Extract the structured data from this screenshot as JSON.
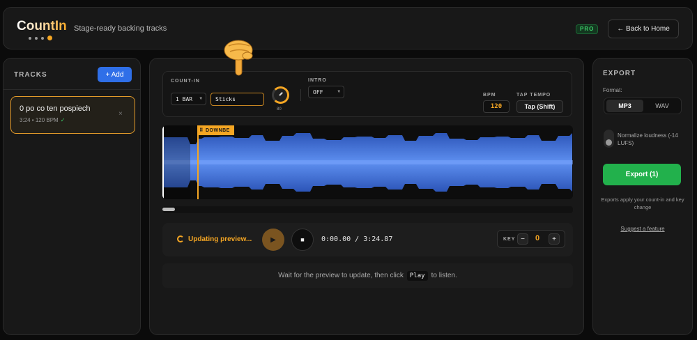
{
  "header": {
    "logo": "CountIn",
    "tagline": "Stage-ready backing tracks",
    "pro_badge": "PRO",
    "home_button": "← Back to Home"
  },
  "tracks": {
    "title": "TRACKS",
    "add_button": "+ Add",
    "items": [
      {
        "name": "0 po co ten pospiech",
        "meta": "3:24 • 120 BPM",
        "status": "✓",
        "remove": "×"
      }
    ]
  },
  "controls": {
    "count_in_label": "COUNT-IN",
    "count_in_value": "1 BAR",
    "sound_value": "Sticks",
    "volume_value": "80",
    "volume_level": 0.8,
    "intro_label": "INTRO",
    "intro_value": "OFF",
    "bpm_label": "BPM",
    "bpm_value": "120",
    "tap_tempo_label": "TAP TEMPO",
    "tap_tempo_button": "Tap (Shift)"
  },
  "waveform": {
    "marker_label": "DOWNBE",
    "color": "#3a6ee0"
  },
  "transport": {
    "status": "Updating preview...",
    "play_icon": "▶",
    "stop_icon": "■",
    "time": "0:00.00 / 3:24.87",
    "key_label": "KEY",
    "key_minus": "−",
    "key_value": "0",
    "key_plus": "+"
  },
  "hint": {
    "before": "Wait for the preview to update, then click",
    "play": "Play",
    "after": "to listen."
  },
  "export": {
    "title": "EXPORT",
    "format_label": "Format:",
    "format_mp3": "MP3",
    "format_wav": "WAV",
    "selected_format": "MP3",
    "normalize_label": "Normalize loudness (-14 LUFS)",
    "normalize_on": false,
    "export_button": "Export (1)",
    "note": "Exports apply your count-in and key change",
    "suggest_link": "Suggest a feature"
  },
  "colors": {
    "accent": "#f5a623",
    "primary": "#2f6fe8",
    "success": "#22b14c"
  }
}
